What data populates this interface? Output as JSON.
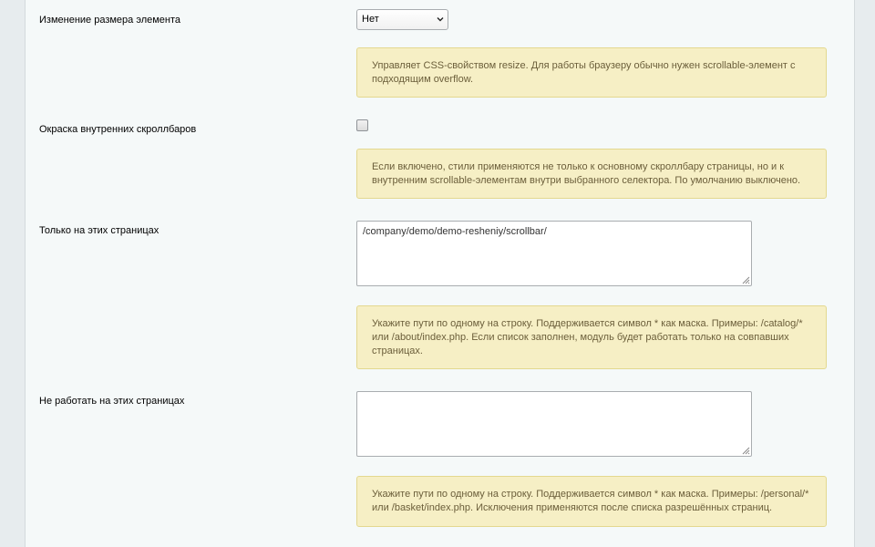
{
  "resize": {
    "label": "Изменение размера элемента",
    "selected": "Нет",
    "hint": "Управляет CSS-свойством resize. Для работы браузеру обычно нужен scrollable-элемент с подходящим overflow."
  },
  "inner_scrollbars": {
    "label": "Окраска внутренних скроллбаров",
    "checked": false,
    "hint": "Если включено, стили применяются не только к основному скроллбару страницы, но и к внутренним scrollable-элементам внутри выбранного селектора. По умолчанию выключено."
  },
  "only_pages": {
    "label": "Только на этих страницах",
    "value": "/company/demo/demo-resheniy/scrollbar/",
    "hint": "Укажите пути по одному на строку. Поддерживается символ * как маска. Примеры: /catalog/* или /about/index.php. Если список заполнен, модуль будет работать только на совпавших страницах."
  },
  "exclude_pages": {
    "label": "Не работать на этих страницах",
    "value": "",
    "hint": "Укажите пути по одному на строку. Поддерживается символ * как маска. Примеры: /personal/* или /basket/index.php. Исключения применяются после списка разрешённых страниц."
  },
  "icons": {
    "select_chevron": "chevron-down-icon",
    "resize_grip": "resize-grip-icon"
  }
}
